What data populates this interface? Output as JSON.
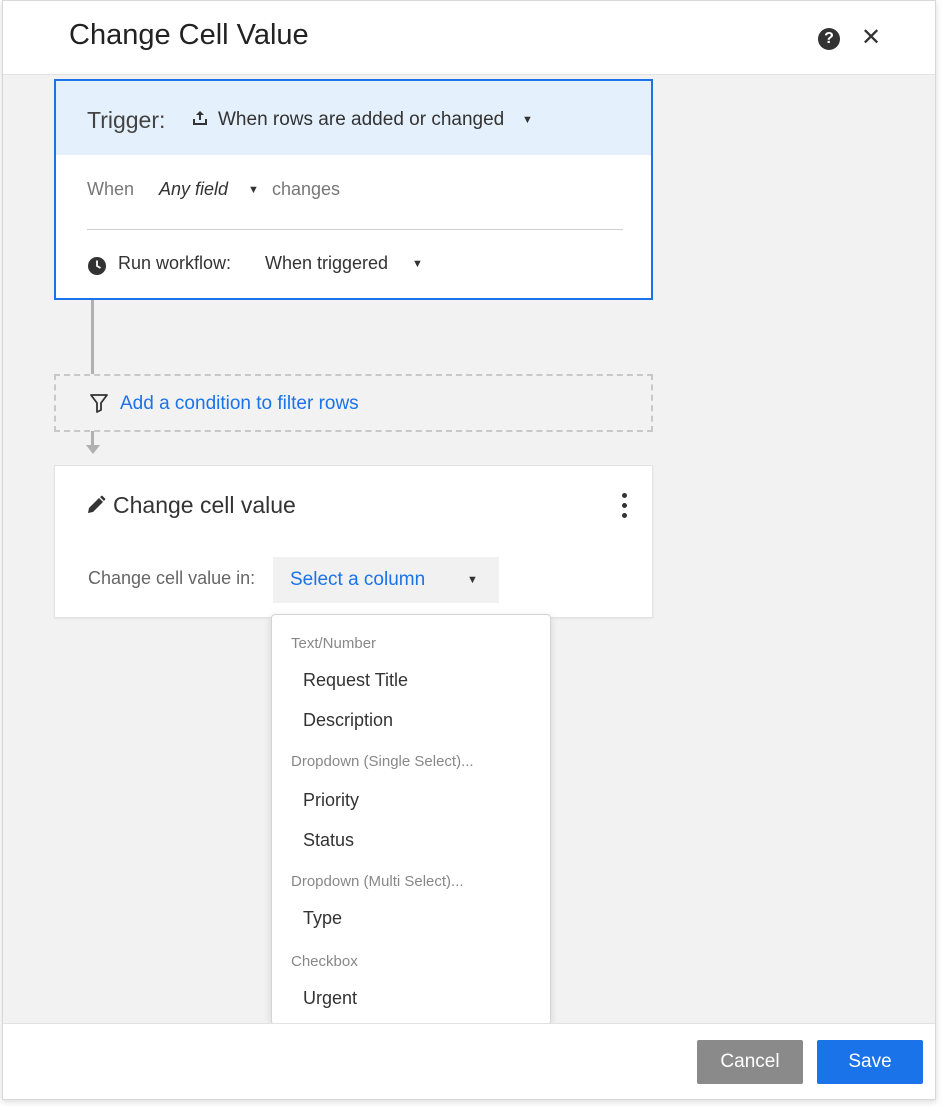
{
  "dialog": {
    "title": "Change Cell Value",
    "help_glyph": "?",
    "close_glyph": "✕"
  },
  "trigger": {
    "label": "Trigger:",
    "value": "When rows are added or changed",
    "when_label": "When",
    "field": "Any field",
    "changes_text": "changes",
    "run_label": "Run workflow:",
    "run_value": "When triggered"
  },
  "condition": {
    "text": "Add a condition to filter rows"
  },
  "action": {
    "title": "Change cell value",
    "column_label": "Change cell value in:",
    "column_placeholder": "Select a column"
  },
  "menu": {
    "groups": [
      {
        "label": "Text/Number",
        "items": [
          "Request Title",
          "Description"
        ]
      },
      {
        "label": "Dropdown (Single Select)...",
        "items": [
          "Priority",
          "Status"
        ]
      },
      {
        "label": "Dropdown (Multi Select)...",
        "items": [
          "Type"
        ]
      },
      {
        "label": "Checkbox",
        "items": [
          "Urgent"
        ]
      }
    ]
  },
  "footer": {
    "cancel_label": "Cancel",
    "save_label": "Save"
  },
  "colors": {
    "accent": "#1a73e8",
    "trigger_header_bg": "#e4f0fb",
    "cancel_bg": "#8a8a8a"
  }
}
